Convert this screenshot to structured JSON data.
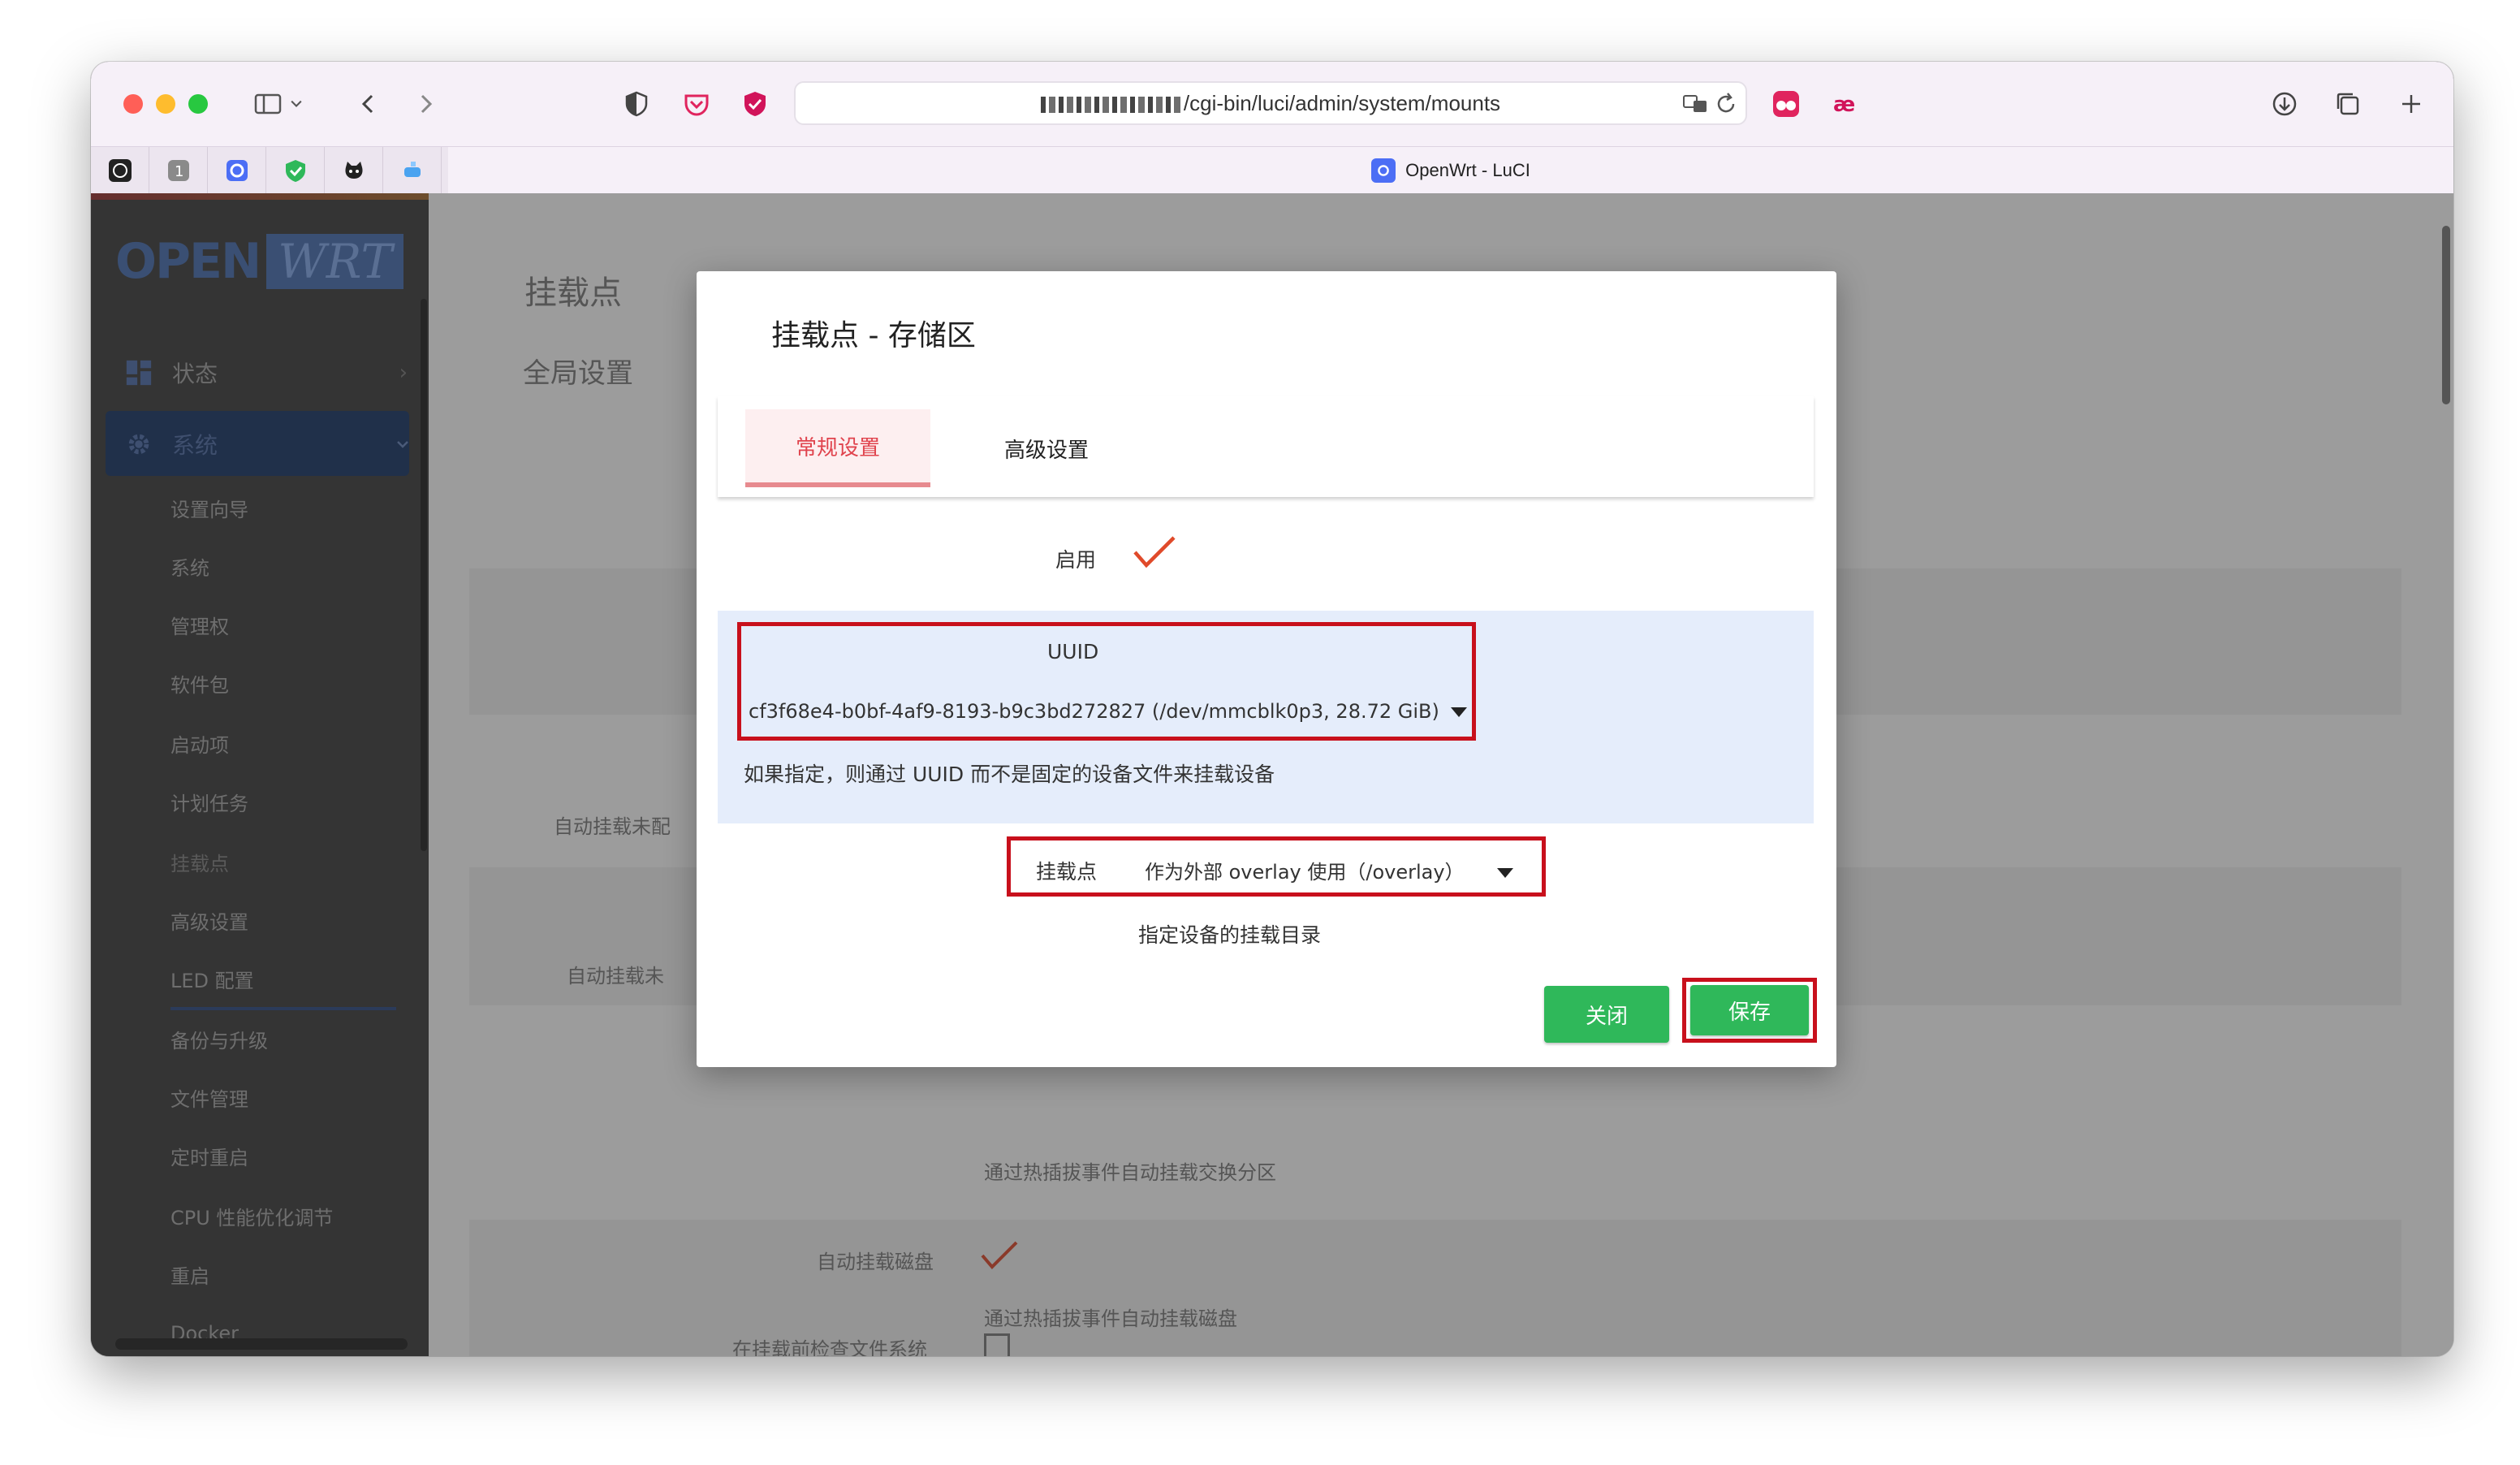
{
  "browser": {
    "url": "/cgi-bin/luci/admin/system/mounts",
    "tab_title": "OpenWrt - LuCI",
    "colors": {
      "close": "#ff5f57",
      "minimize": "#febc2e",
      "zoom": "#28c840"
    }
  },
  "sidebar": {
    "logo_open": "OPEN",
    "logo_wrt": "WRT",
    "nav": [
      {
        "label": "状态",
        "icon": "dashboard-icon"
      },
      {
        "label": "系统",
        "icon": "gear-icon"
      }
    ],
    "system_items": [
      "设置向导",
      "系统",
      "管理权",
      "软件包",
      "启动项",
      "计划任务",
      "挂载点",
      "高级设置",
      "LED 配置",
      "备份与升级",
      "文件管理",
      "定时重启",
      "CPU 性能优化调节",
      "重启"
    ],
    "next_section": "Docker"
  },
  "page": {
    "title": "挂载点",
    "section": "全局设置",
    "label_auto_mount_unconfigured": "自动挂载未配",
    "label_auto_mount_unconfigured_2": "自动挂载未",
    "swap_description": "通过热插拔事件自动挂载交换分区",
    "auto_mount_disk_label": "自动挂载磁盘",
    "auto_mount_disk_description": "通过热插拔事件自动挂载磁盘",
    "check_fs_label": "在挂载前检查文件系统"
  },
  "modal": {
    "title": "挂载点 - 存储区",
    "tabs": [
      "常规设置",
      "高级设置"
    ],
    "enable_label": "启用",
    "uuid": {
      "label": "UUID",
      "value": "cf3f68e4-b0bf-4af9-8193-b9c3bd272827 (/dev/mmcblk0p3, 28.72 GiB)",
      "description": "如果指定，则通过 UUID 而不是固定的设备文件来挂载设备"
    },
    "mount_point": {
      "label": "挂载点",
      "value": "作为外部 overlay 使用（/overlay）",
      "description": "指定设备的挂载目录"
    },
    "buttons": {
      "close": "关闭",
      "save": "保存"
    },
    "colors": {
      "accent_tab": "#e0434d",
      "highlight": "#c8101c",
      "button": "#2fb85a"
    }
  }
}
